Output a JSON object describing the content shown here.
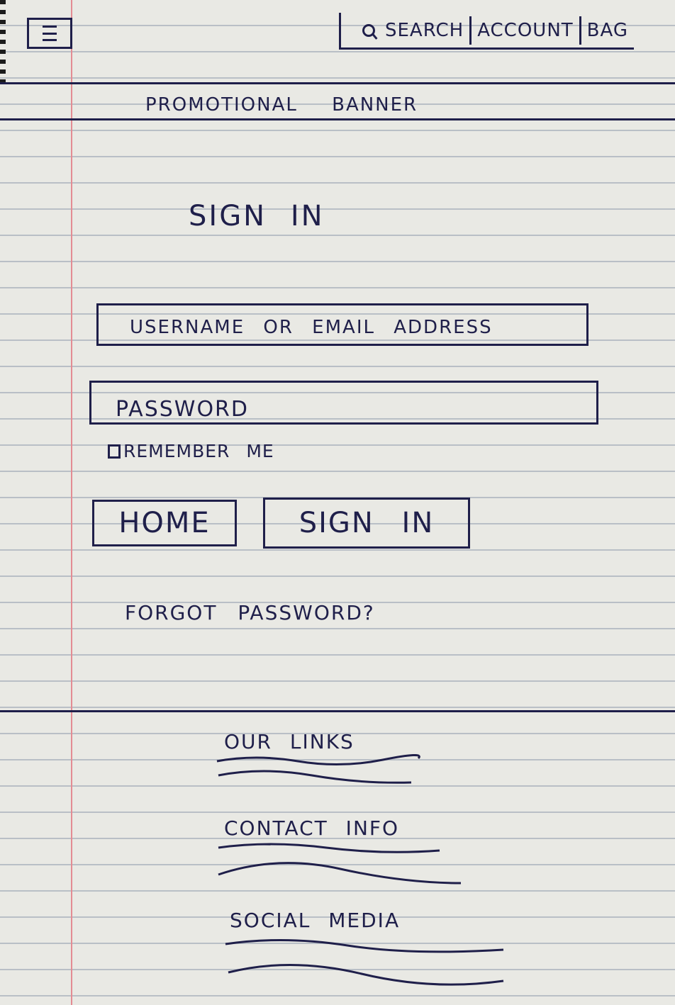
{
  "header": {
    "menu_icon": "hamburger-menu-icon",
    "search_label": "SEARCH",
    "account_label": "ACCOUNT",
    "bag_label": "BAG"
  },
  "promo": {
    "text": "PROMOTIONAL BANNER"
  },
  "page": {
    "title": "SIGN IN"
  },
  "form": {
    "username_placeholder": "USERNAME OR EMAIL ADDRESS",
    "password_placeholder": "PASSWORD",
    "remember_label": "REMEMBER ME",
    "home_button": "HOME",
    "signin_button": "SIGN IN",
    "forgot_link": "FORGOT PASSWORD?"
  },
  "footer": {
    "links_heading": "OUR LINKS",
    "contact_heading": "CONTACT INFO",
    "social_heading": "SOCIAL MEDIA"
  },
  "colors": {
    "ink": "#1f1f4a",
    "paper": "#e9e9e4",
    "rule": "#b9bfc6",
    "margin": "#e38c93"
  }
}
